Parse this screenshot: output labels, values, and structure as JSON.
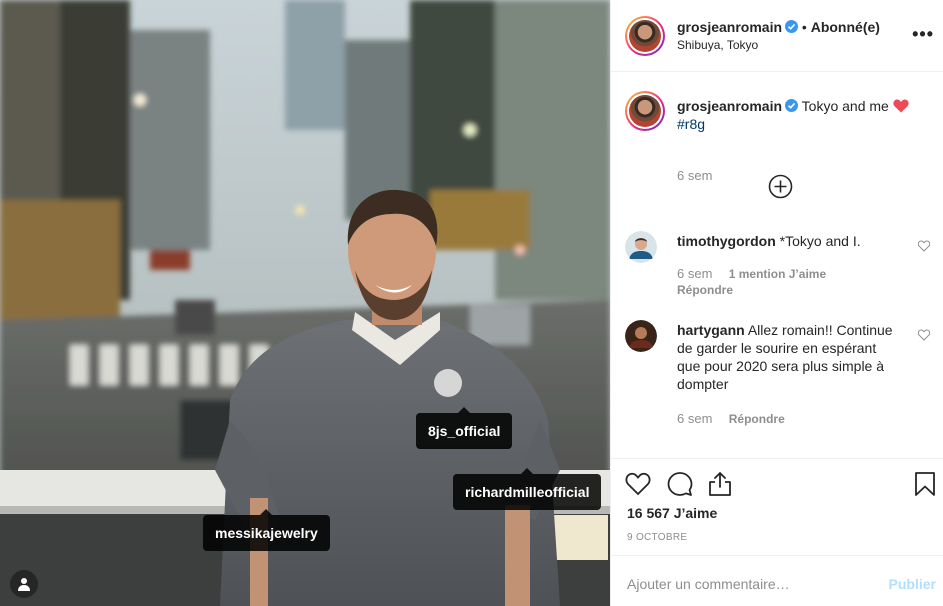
{
  "header": {
    "username": "grosjeanromain",
    "separator": "•",
    "follow_status": "Abonné(e)",
    "location": "Shibuya, Tokyo",
    "more_label": "•••"
  },
  "photo": {
    "tags": [
      "8js_official",
      "richardmilleofficial",
      "messikajewelry"
    ]
  },
  "caption": {
    "username": "grosjeanromain",
    "text": "Tokyo and me",
    "hashtag": "#r8g",
    "time": "6 sem"
  },
  "comments": [
    {
      "username": "timothygordon",
      "text": "*Tokyo and I.",
      "time": "6 sem",
      "likes": "1 mention J’aime",
      "reply": "Répondre"
    },
    {
      "username": "hartygann",
      "text": "Allez romain!! Continue de garder le sourire en espérant que pour 2020 sera plus simple à dompter",
      "time": "6 sem",
      "reply": "Répondre"
    }
  ],
  "stats": {
    "likes": "16 567 J’aime",
    "date": "9 OCTOBRE"
  },
  "composer": {
    "placeholder": "Ajouter un commentaire…",
    "publish_label": "Publier"
  },
  "colors": {
    "verified": "#3897f0",
    "heart": "#ed4956",
    "hashtag": "#00376b",
    "publish_disabled": "#b2dffc"
  },
  "icons": [
    "verified-badge-icon",
    "heart-emoji-icon",
    "load-more-comments-icon",
    "like-icon",
    "comment-icon",
    "share-icon",
    "save-icon",
    "user-tags-icon",
    "comment-like-icon"
  ]
}
